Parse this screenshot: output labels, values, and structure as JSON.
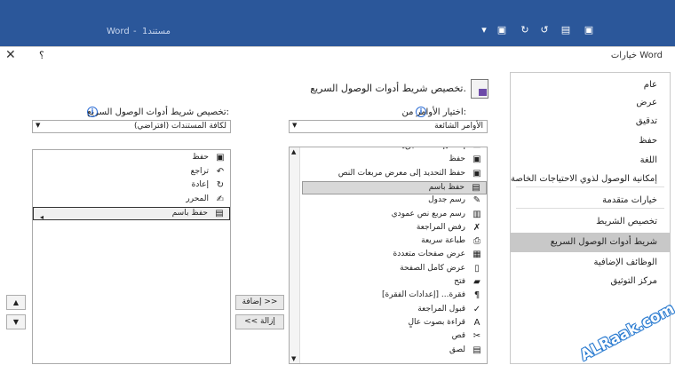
{
  "word_bar": {
    "doc_title": "مستند1",
    "app_name": "Word",
    "sep": "-"
  },
  "dialog": {
    "title": "خيارات Word",
    "help": "؟",
    "close": "✕"
  },
  "nav": {
    "items": [
      "عام",
      "عرض",
      "تدقيق",
      "حفظ",
      "اللغة",
      "إمكانية الوصول لذوي الاحتياجات الخاصة",
      "خيارات متقدمة",
      "تخصيص الشريط",
      "شريط أدوات الوصول السريع",
      "الوظائف الإضافية",
      "مركز التوثيق"
    ],
    "selected": 8
  },
  "header": {
    "title": "تخصيص شريط أدوات الوصول السريع."
  },
  "choose": {
    "label": "اختيار الأوامر من:",
    "value": "الأوامر الشائعة"
  },
  "customize": {
    "label": "تخصيص شريط أدوات الوصول السريع:",
    "value": "لكافة المستندات (افتراضي)"
  },
  "commands": [
    {
      "label": "إلغاء [إلغاء التعليق]",
      "icon": "comment-icon"
    },
    {
      "label": "حفظ",
      "icon": "save-icon"
    },
    {
      "label": "حفظ التحديد إلى معرض مربعات النص",
      "icon": "textbox-save-icon"
    },
    {
      "label": "حفظ باسم",
      "icon": "save-as-icon"
    },
    {
      "label": "رسم جدول",
      "icon": "draw-table-icon"
    },
    {
      "label": "رسم مربع نص عمودي",
      "icon": "vertical-textbox-icon"
    },
    {
      "label": "رفض المراجعة",
      "icon": "reject-icon"
    },
    {
      "label": "طباعة سريعة",
      "icon": "print-icon"
    },
    {
      "label": "عرض صفحات متعددة",
      "icon": "multipage-icon"
    },
    {
      "label": "عرض كامل الصفحة",
      "icon": "page-icon"
    },
    {
      "label": "فتح",
      "icon": "folder-icon"
    },
    {
      "label": "فقرة... [إعدادات الفقرة]",
      "icon": "paragraph-icon"
    },
    {
      "label": "قبول المراجعة",
      "icon": "accept-icon"
    },
    {
      "label": "قراءة بصوت عالٍ",
      "icon": "read-aloud-icon"
    },
    {
      "label": "قص",
      "icon": "scissors-icon"
    },
    {
      "label": "لصق",
      "icon": "paste-icon"
    }
  ],
  "commands_selected": 3,
  "qat": [
    {
      "label": "حفظ",
      "icon": "save-icon"
    },
    {
      "label": "تراجع",
      "icon": "undo-icon"
    },
    {
      "label": "إعادة",
      "icon": "redo-icon"
    },
    {
      "label": "المحرر",
      "icon": "editor-icon"
    },
    {
      "label": "حفظ باسم",
      "icon": "save-as-icon"
    }
  ],
  "qat_focus": 4,
  "buttons": {
    "add": "إضافة >>",
    "remove": "<< إزالة"
  },
  "watermark": "ALRaak.com",
  "colors": {
    "word_blue": "#2b579a",
    "save_purple": "#6d4aa8",
    "info_blue": "#2b6cd4"
  }
}
